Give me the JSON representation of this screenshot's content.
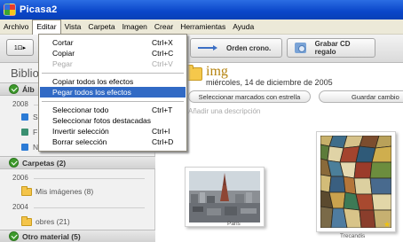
{
  "window": {
    "title": "Picasa2"
  },
  "menubar": [
    {
      "label": "Archivo",
      "open": false
    },
    {
      "label": "Editar",
      "open": true
    },
    {
      "label": "Vista",
      "open": false
    },
    {
      "label": "Carpeta",
      "open": false
    },
    {
      "label": "Imagen",
      "open": false
    },
    {
      "label": "Crear",
      "open": false
    },
    {
      "label": "Herramientas",
      "open": false
    },
    {
      "label": "Ayuda",
      "open": false
    }
  ],
  "edit_menu": {
    "items": [
      {
        "label": "Cortar",
        "shortcut": "Ctrl+X",
        "disabled": false,
        "highlighted": false
      },
      {
        "label": "Copiar",
        "shortcut": "Ctrl+C",
        "disabled": false,
        "highlighted": false
      },
      {
        "label": "Pegar",
        "shortcut": "Ctrl+V",
        "disabled": true,
        "highlighted": false
      },
      {
        "label": "Copiar todos los efectos",
        "shortcut": "",
        "disabled": false,
        "highlighted": false
      },
      {
        "label": "Pegar todos los efectos",
        "shortcut": "",
        "disabled": false,
        "highlighted": true
      },
      {
        "label": "Seleccionar todo",
        "shortcut": "Ctrl+T",
        "disabled": false,
        "highlighted": false
      },
      {
        "label": "Seleccionar fotos destacadas",
        "shortcut": "",
        "disabled": false,
        "highlighted": false
      },
      {
        "label": "Invertir selección",
        "shortcut": "Ctrl+I",
        "disabled": false,
        "highlighted": false
      },
      {
        "label": "Borrar selección",
        "shortcut": "Ctrl+D",
        "disabled": false,
        "highlighted": false
      }
    ]
  },
  "toolbar": {
    "left_button_label": "1⊡▸",
    "chrono_label": "Orden crono.",
    "chrono_icon": "chronological-arrow-icon",
    "cd_label": "Grabar CD regalo",
    "cd_icon": "cd-icon"
  },
  "library": {
    "title": "Biblio",
    "albums_header": "Álb",
    "year1": "2008",
    "folders_header": "Carpetas (2)",
    "year2": "2006",
    "folder1": "Mis imágenes (8)",
    "year3": "2004",
    "folder2": "obres (21)",
    "other_header": "Otro material (5)",
    "partial_items": [
      "S",
      "F",
      "N"
    ]
  },
  "album": {
    "title": "img",
    "date": "miércoles, 14 de diciembre de 2005",
    "star_button": "Seleccionar marcados con estrella",
    "save_button": "Guardar cambio",
    "description_placeholder": "Añadir una descripción",
    "photos": [
      {
        "caption": "Paris"
      },
      {
        "caption": "Trecandis"
      }
    ]
  },
  "colors": {
    "titlebar": "#0a46c9",
    "highlight": "#316ac5",
    "album_title": "#b5830f",
    "folder": "#f5c84b",
    "check": "#3d9a2b"
  }
}
